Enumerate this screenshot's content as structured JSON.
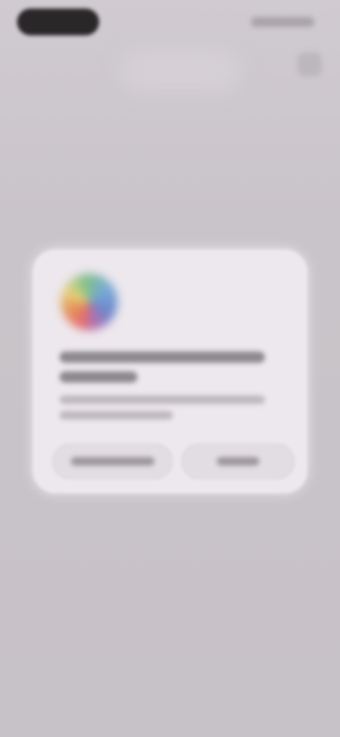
{
  "status_bar": {
    "time_pill": "",
    "indicators": ""
  },
  "header": {
    "action_icon": "more-icon"
  },
  "dialog": {
    "icon": "app-logo-icon",
    "title": "",
    "message": "",
    "secondary_button_label": "",
    "primary_button_label": ""
  },
  "colors": {
    "background": "#c9c4c9",
    "dialog_background": "#ede8ed",
    "button_background": "#e2dde2"
  }
}
